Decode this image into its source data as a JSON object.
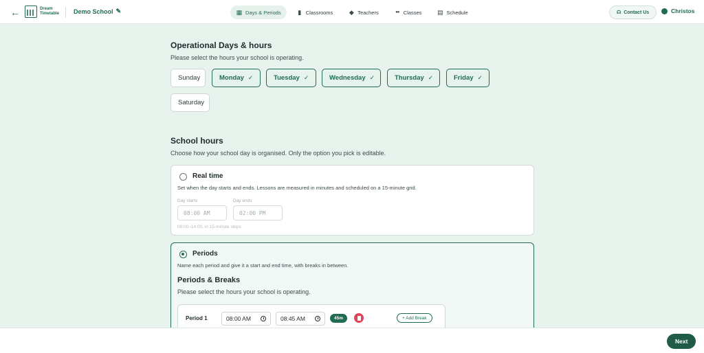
{
  "header": {
    "logo_line1": "Dream",
    "logo_line2": "Timetable",
    "school_name": "Demo School",
    "nav": [
      {
        "label": "Days & Periods",
        "icon": "calendar-icon",
        "glyph": "▦"
      },
      {
        "label": "Classrooms",
        "icon": "door-icon",
        "glyph": "▮"
      },
      {
        "label": "Teachers",
        "icon": "graduation-cap-icon",
        "glyph": "◆"
      },
      {
        "label": "Classes",
        "icon": "group-icon",
        "glyph": "●●"
      },
      {
        "label": "Schedule",
        "icon": "calendar-grid-icon",
        "glyph": "▤"
      }
    ],
    "contact_label": "Contact Us",
    "user_name": "Christos"
  },
  "operational": {
    "title": "Operational Days & hours",
    "subtitle": "Please select the hours your school is operating.",
    "days": [
      {
        "label": "Sunday",
        "selected": false
      },
      {
        "label": "Monday",
        "selected": true
      },
      {
        "label": "Tuesday",
        "selected": true
      },
      {
        "label": "Wednesday",
        "selected": true
      },
      {
        "label": "Thursday",
        "selected": true
      },
      {
        "label": "Friday",
        "selected": true
      },
      {
        "label": "Saturday",
        "selected": false
      }
    ],
    "check_glyph": "✓"
  },
  "school_hours": {
    "title": "School hours",
    "subtitle": "Choose how your school day is organised. Only the option you pick is editable.",
    "realtime": {
      "title": "Real time",
      "description": "Set when the day starts and ends. Lessons are measured in minutes and scheduled on a 15-minute grid.",
      "day_starts_label": "Day starts",
      "day_ends_label": "Day ends",
      "day_starts_value": "08:00 AM",
      "day_ends_value": "02:00 PM",
      "hint": "08:00–14:00, in 15-minute steps",
      "selected": false
    },
    "periods": {
      "title": "Periods",
      "description": "Name each period and give it a start and end time, with breaks in between.",
      "selected": true
    }
  },
  "periods_breaks": {
    "title": "Periods & Breaks",
    "subtitle": "Please select the hours your school is operating.",
    "rows": [
      {
        "name": "Period 1",
        "start": "08:00 AM",
        "end": "08:45 AM",
        "duration": "45m",
        "add_break_label": "+ Add Break"
      }
    ]
  },
  "footer": {
    "next_label": "Next"
  },
  "colors": {
    "accent": "#1f6b54",
    "background": "#e8f3ee",
    "danger": "#e0435a"
  }
}
